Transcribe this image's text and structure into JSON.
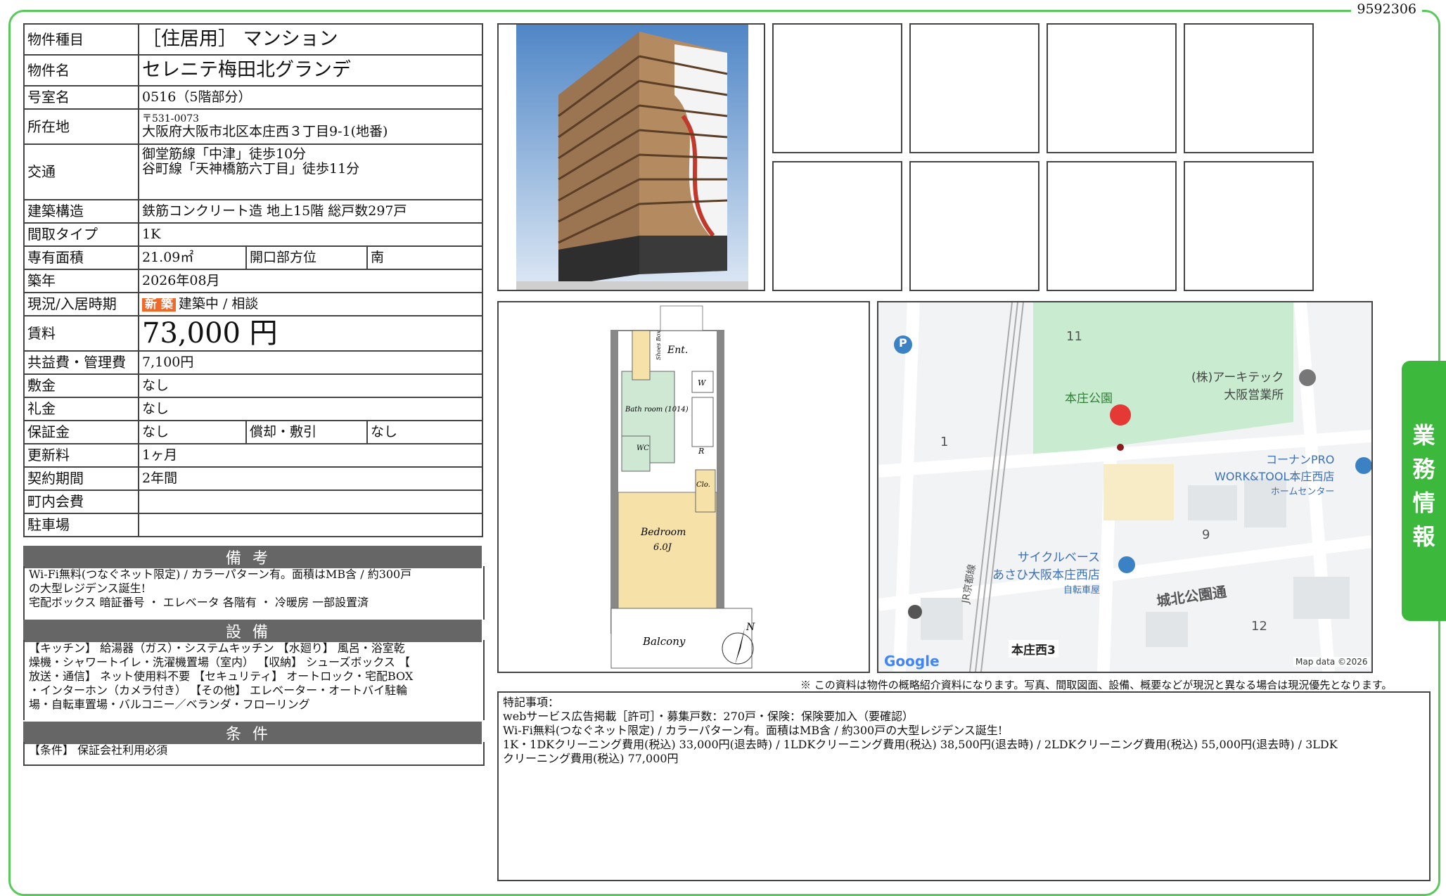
{
  "doc_id": "9592306",
  "side_tab": [
    "業",
    "務",
    "情",
    "報"
  ],
  "property": {
    "type_label": "物件種目",
    "type_value": "［住居用］ マンション",
    "name_label": "物件名",
    "name_value": "セレニテ梅田北グランデ",
    "room_label": "号室名",
    "room_value": "0516（5階部分）",
    "address_label": "所在地",
    "address_zip": "〒531-0073",
    "address_value": "大阪府大阪市北区本庄西３丁目9-1(地番)",
    "transit_label": "交通",
    "transit_1": "御堂筋線「中津」徒歩10分",
    "transit_2": "谷町線「天神橋筋六丁目」徒歩11分",
    "structure_label": "建築構造",
    "structure_value": "鉄筋コンクリート造 地上15階 総戸数297戸",
    "layout_label": "間取タイプ",
    "layout_value": "1K",
    "area_label": "専有面積",
    "area_value": "21.09㎡",
    "direction_label": "開口部方位",
    "direction_value": "南",
    "built_label": "築年",
    "built_value": "2026年08月",
    "status_label": "現況/入居時期",
    "status_badge": "新 築",
    "status_value": "建築中 / 相談",
    "rent_label": "賃料",
    "rent_value": "73,000 円",
    "fee_label": "共益費・管理費",
    "fee_value": "7,100円",
    "deposit_label": "敷金",
    "deposit_value": "なし",
    "keymoney_label": "礼金",
    "keymoney_value": "なし",
    "guarantee_label": "保証金",
    "guarantee_value": "なし",
    "amort_label": "償却・敷引",
    "amort_value": "なし",
    "renewal_label": "更新料",
    "renewal_value": "1ヶ月",
    "contract_label": "契約期間",
    "contract_value": "2年間",
    "community_label": "町内会費",
    "community_value": "",
    "parking_label": "駐車場",
    "parking_value": ""
  },
  "notes": {
    "title": "備考",
    "line1": "Wi-Fi無料(つなぐネット限定) / カラーパターン有。面積はMB含 / 約300戸",
    "line2": "の大型レジデンス誕生!",
    "line3": "宅配ボックス 暗証番号 ・ エレベータ 各階有 ・ 冷暖房 一部設置済"
  },
  "equipment": {
    "title": "設備",
    "line1": "【キッチン】 給湯器（ガス）・システムキッチン 【水廻り】 風呂・浴室乾",
    "line2": "燥機・シャワートイレ・洗濯機置場（室内） 【収納】 シューズボックス 【",
    "line3": "放送・通信】 ネット使用料不要 【セキュリティ】 オートロック・宅配BOX",
    "line4": "・インターホン（カメラ付き） 【その他】 エレベーター・オートバイ駐輪",
    "line5": "場・自転車置場・バルコニー／ベランダ・フローリング"
  },
  "conditions": {
    "title": "条件",
    "line1": "【条件】 保証会社利用必須"
  },
  "floorplan": {
    "ent": "Ent.",
    "shoe": "Shoes Box",
    "bath": "Bath room (1014)",
    "wc": "WC",
    "w": "W",
    "r": "R",
    "clo": "Clo.",
    "bedroom": "Bedroom",
    "bedroom_size": "6.0J",
    "balcony": "Balcony",
    "north": "N"
  },
  "map": {
    "park": "本庄公園",
    "shop1": "(株)アーキテック",
    "shop1b": "大阪営業所",
    "shop2": "コーナンPRO",
    "shop2b": "WORK&TOOL本庄西店",
    "shop2c": "ホームセンター",
    "shop3": "サイクルベース",
    "shop3b": "あさひ大阪本庄西店",
    "shop3c": "自転車屋",
    "road": "城北公園通",
    "rail": "JR京都線",
    "station": "本庄西3",
    "n11": "11",
    "n1": "1",
    "n9": "9",
    "n12": "12",
    "p": "P",
    "google": "Google",
    "credit": "Map data ©2026"
  },
  "disclaimer": "※ この資料は物件の概略紹介資料になります。写真、間取図面、設備、概要などが現況と異なる場合は現況優先となります。",
  "remarks": {
    "title": "特記事項：",
    "line1": "webサービス広告掲載［許可］・募集戸数：270戸・保険：保険要加入（要確認）",
    "line2": "Wi-Fi無料(つなぐネット限定) / カラーパターン有。面積はMB含 / 約300戸の大型レジデンス誕生!",
    "line3": "1K・1DKクリーニング費用(税込) 33,000円(退去時) / 1LDKクリーニング費用(税込) 38,500円(退去時) / 2LDKクリーニング費用(税込) 55,000円(退去時) / 3LDK",
    "line4": "クリーニング費用(税込) 77,000円"
  },
  "colors": {
    "frame": "#5ac85a",
    "tab": "#3cb83c",
    "badge": "#ee6a2a",
    "section": "#666666",
    "park": "#c9ecd1",
    "pin": "#e53935"
  }
}
